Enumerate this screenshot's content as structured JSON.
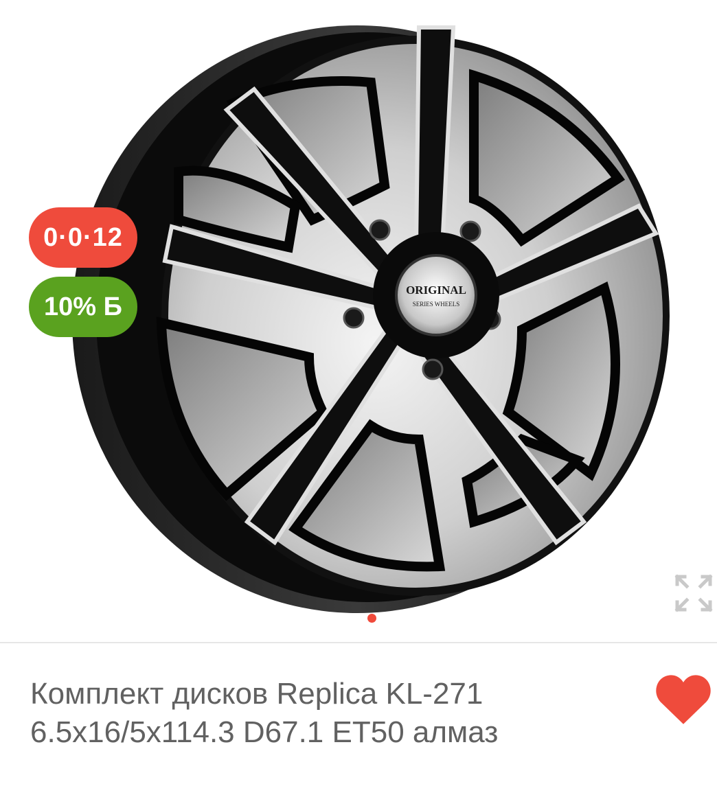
{
  "gallery": {
    "image_alt": "Комплект дисков Replica KL-271",
    "hub_cap_line1": "ORIGINAL",
    "hub_cap_line2": "SERIES WHEELS",
    "slide_count": 1,
    "active_slide": 1
  },
  "badges": {
    "installment": "0·0·12",
    "cashback": "10% Б"
  },
  "icons": {
    "expand": "expand-arrows-icon",
    "favorite": "heart-icon"
  },
  "product": {
    "title": "Комплект дисков Replica KL-271 6.5x16/5x114.3 D67.1 ET50 алмаз",
    "favorite": true
  },
  "colors": {
    "accent": "#f04a3b",
    "installment_badge": "#ef4b3c",
    "cashback_badge": "#5aa21f",
    "favorite": "#ef4b3c",
    "title_text": "#616161",
    "divider": "#e6e6e6"
  }
}
